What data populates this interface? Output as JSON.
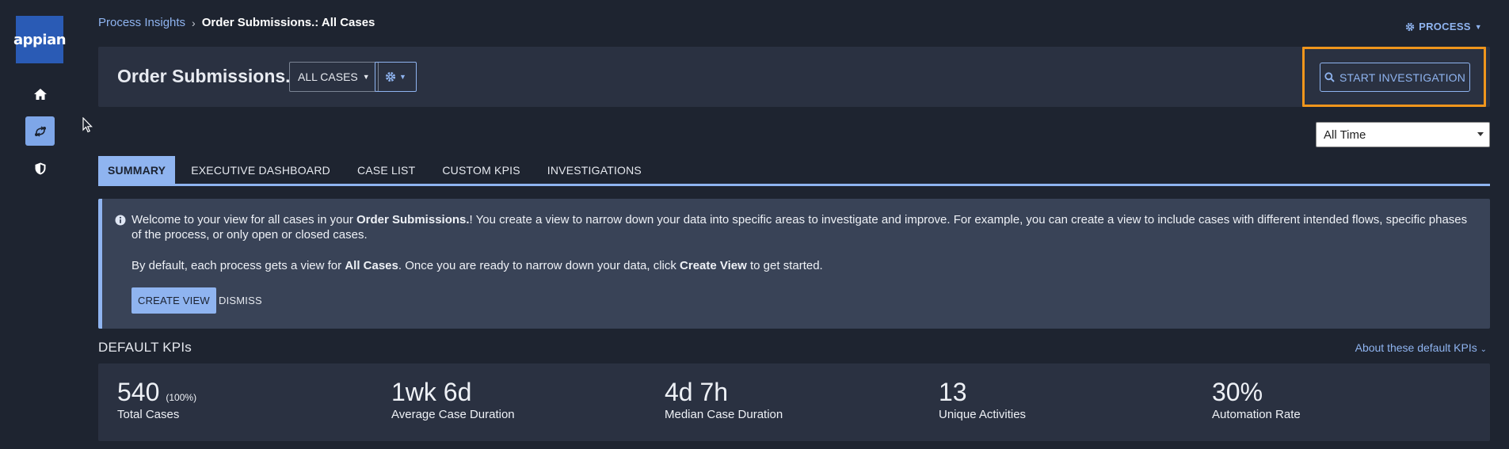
{
  "app": {
    "logo_text": "appian"
  },
  "nav": {
    "items": [
      "home-icon",
      "process-flow-icon",
      "shield-icon"
    ]
  },
  "breadcrumb": {
    "parent": "Process Insights",
    "current": "Order Submissions.: All Cases"
  },
  "process_menu": {
    "label": "PROCESS"
  },
  "header": {
    "title": "Order Submissions.",
    "view_dropdown": "ALL CASES",
    "start_button": "START INVESTIGATION"
  },
  "time_filter": {
    "selected": "All Time"
  },
  "tabs": [
    {
      "label": "SUMMARY",
      "active": true
    },
    {
      "label": "EXECUTIVE DASHBOARD"
    },
    {
      "label": "CASE LIST"
    },
    {
      "label": "CUSTOM KPIS"
    },
    {
      "label": "INVESTIGATIONS"
    }
  ],
  "info": {
    "p1_a": "Welcome to your view for all cases in your ",
    "p1_b": "Order Submissions.",
    "p1_c": "! You create a view to narrow down your data into specific areas to investigate and improve. For example, you can create a view to include cases with different intended flows, specific phases of the process, or only open or closed cases.",
    "p2_a": "By default, each process gets a view for ",
    "p2_b": "All Cases",
    "p2_c": ". Once you are ready to narrow down your data, click ",
    "p2_d": "Create View",
    "p2_e": " to get started.",
    "create_button": "CREATE VIEW",
    "dismiss_button": "DISMISS"
  },
  "kpis": {
    "heading": "DEFAULT KPIs",
    "about_link": "About these default KPIs",
    "items": [
      {
        "value": "540",
        "extra": "(100%)",
        "label": "Total Cases"
      },
      {
        "value": "1wk 6d",
        "label": "Average Case Duration"
      },
      {
        "value": "4d 7h",
        "label": "Median Case Duration"
      },
      {
        "value": "13",
        "label": "Unique Activities"
      },
      {
        "value": "30%",
        "label": "Automation Rate"
      }
    ]
  },
  "colors": {
    "accent": "#8fb4f0",
    "highlight": "#f0961c",
    "background": "#1e2430",
    "card": "#2a3141",
    "logo": "#2a5bb5"
  }
}
